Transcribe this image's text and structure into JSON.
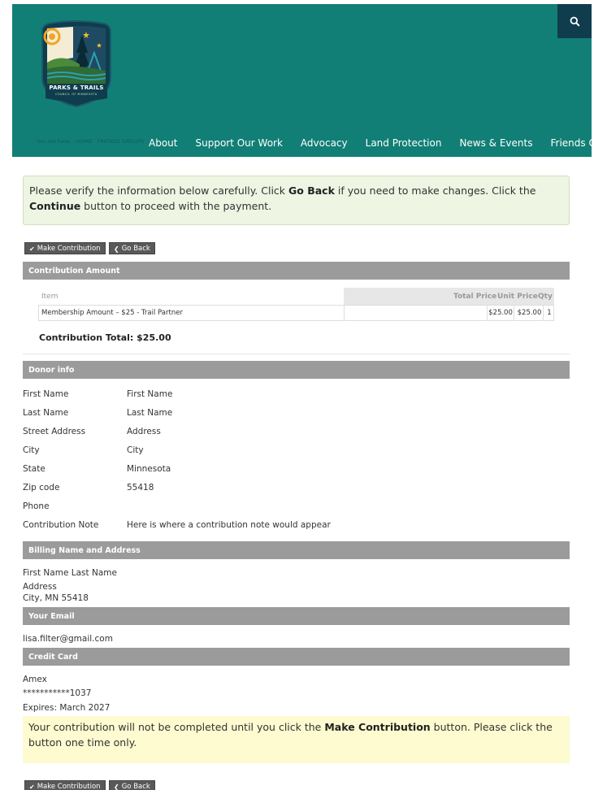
{
  "header": {
    "logo_title": "PARKS & TRAILS",
    "logo_subtitle": "COUNCIL OF MINNESOTA",
    "breadcrumb": [
      "You are here:",
      "HOME",
      "FRIENDS GROUPS"
    ],
    "nav": [
      "About",
      "Support Our Work",
      "Advocacy",
      "Land Protection",
      "News & Events",
      "Friends Groups"
    ],
    "search_icon": "search-icon"
  },
  "verify": {
    "t1": "Please verify the information below carefully. Click ",
    "b1": "Go Back",
    "t2": " if you need to make changes. Click the ",
    "b2": "Continue",
    "t3": " button to proceed with the payment."
  },
  "buttons": {
    "make": "Make Contribution",
    "back": "Go Back"
  },
  "contribution": {
    "heading": "Contribution Amount",
    "columns": {
      "item": "Item",
      "total": "Total Price",
      "unit": "Unit Price",
      "qty": "Qty"
    },
    "row": {
      "item": "Membership Amount – $25 - Trail Partner",
      "total": "$25.00",
      "unit": "$25.00",
      "qty": "1"
    },
    "total": "Contribution Total: $25.00"
  },
  "donor": {
    "heading": "Donor info",
    "fields": [
      {
        "label": "First Name",
        "value": "First Name"
      },
      {
        "label": "Last Name",
        "value": "Last Name"
      },
      {
        "label": "Street Address",
        "value": "Address"
      },
      {
        "label": "City",
        "value": "City"
      },
      {
        "label": "State",
        "value": "Minnesota"
      },
      {
        "label": "Zip code",
        "value": "55418"
      },
      {
        "label": "Phone",
        "value": ""
      },
      {
        "label": "Contribution Note",
        "value": "Here is where a contribution note would appear"
      }
    ]
  },
  "billing": {
    "heading": "Billing Name and Address",
    "name": "First Name Last Name",
    "address": "Address",
    "city": "City, MN 55418"
  },
  "email": {
    "heading": "Your Email",
    "value": "lisa.filter@gmail.com"
  },
  "card": {
    "heading": "Credit Card",
    "type": "Amex",
    "number": "***********1037",
    "expires": "Expires: March 2027"
  },
  "final": {
    "t1": "Your contribution will not be completed until you click the ",
    "b1": "Make Contribution",
    "t2": " button. Please click the button one time only."
  },
  "colors": {
    "header": "#127f76",
    "search": "#0f3d4d",
    "section_bar": "#9b9b9b",
    "verify_bg": "#eef5e3",
    "final_bg": "#fdfbcf"
  }
}
